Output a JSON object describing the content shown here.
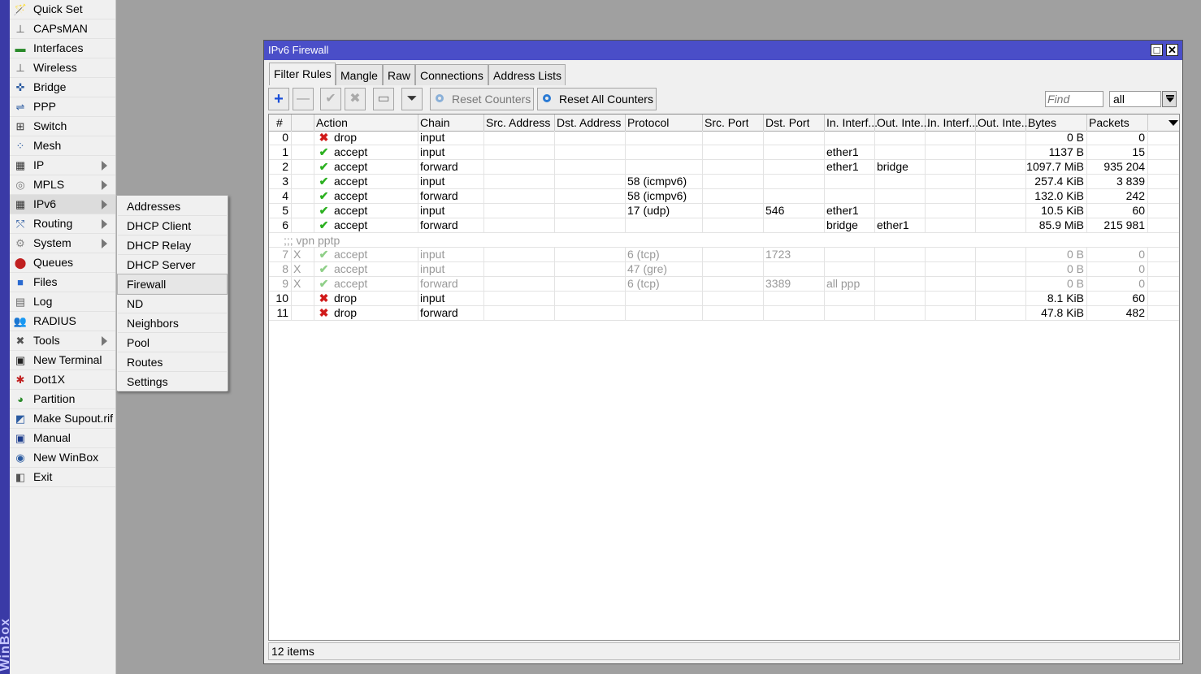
{
  "branding": {
    "side_label": "WinBox"
  },
  "left_menu": [
    {
      "label": "Quick Set",
      "icon": "wand-icon",
      "glyph": "🪄",
      "color": "#555",
      "submenu": false
    },
    {
      "label": "CAPsMAN",
      "icon": "antenna-icon",
      "glyph": "⊥",
      "color": "#555",
      "submenu": false
    },
    {
      "label": "Interfaces",
      "icon": "interfaces-icon",
      "glyph": "▬",
      "color": "#2a8a2a",
      "submenu": false
    },
    {
      "label": "Wireless",
      "icon": "wireless-icon",
      "glyph": "⊥",
      "color": "#555",
      "submenu": false
    },
    {
      "label": "Bridge",
      "icon": "bridge-icon",
      "glyph": "✜",
      "color": "#2a5aa0",
      "submenu": false
    },
    {
      "label": "PPP",
      "icon": "ppp-icon",
      "glyph": "⇌",
      "color": "#2a5aa0",
      "submenu": false
    },
    {
      "label": "Switch",
      "icon": "switch-icon",
      "glyph": "⊞",
      "color": "#333",
      "submenu": false
    },
    {
      "label": "Mesh",
      "icon": "mesh-icon",
      "glyph": "⁘",
      "color": "#2a5aa0",
      "submenu": false
    },
    {
      "label": "IP",
      "icon": "ip-icon",
      "glyph": "▦",
      "color": "#333",
      "submenu": true
    },
    {
      "label": "MPLS",
      "icon": "mpls-icon",
      "glyph": "◎",
      "color": "#777",
      "submenu": true
    },
    {
      "label": "IPv6",
      "icon": "ipv6-icon",
      "glyph": "▦",
      "color": "#333",
      "submenu": true
    },
    {
      "label": "Routing",
      "icon": "routing-icon",
      "glyph": "⤲",
      "color": "#2a5aa0",
      "submenu": true
    },
    {
      "label": "System",
      "icon": "system-gear-icon",
      "glyph": "⚙",
      "color": "#888",
      "submenu": true
    },
    {
      "label": "Queues",
      "icon": "queues-icon",
      "glyph": "⬤",
      "color": "#c02020",
      "submenu": false
    },
    {
      "label": "Files",
      "icon": "files-icon",
      "glyph": "■",
      "color": "#2a6ad0",
      "submenu": false
    },
    {
      "label": "Log",
      "icon": "log-icon",
      "glyph": "▤",
      "color": "#666",
      "submenu": false
    },
    {
      "label": "RADIUS",
      "icon": "radius-icon",
      "glyph": "👥",
      "color": "#2a5aa0",
      "submenu": false
    },
    {
      "label": "Tools",
      "icon": "tools-icon",
      "glyph": "✖",
      "color": "#555",
      "submenu": true
    },
    {
      "label": "New Terminal",
      "icon": "terminal-icon",
      "glyph": "▣",
      "color": "#222",
      "submenu": false
    },
    {
      "label": "Dot1X",
      "icon": "dot1x-icon",
      "glyph": "✱",
      "color": "#c02020",
      "submenu": false
    },
    {
      "label": "Partition",
      "icon": "partition-icon",
      "glyph": "◕",
      "color": "#2a8a2a",
      "submenu": false
    },
    {
      "label": "Make Supout.rif",
      "icon": "supout-icon",
      "glyph": "◩",
      "color": "#2a5aa0",
      "submenu": false
    },
    {
      "label": "Manual",
      "icon": "manual-icon",
      "glyph": "▣",
      "color": "#1a3a8a",
      "submenu": false
    },
    {
      "label": "New WinBox",
      "icon": "winbox-globe-icon",
      "glyph": "◉",
      "color": "#2a5aa0",
      "submenu": false
    },
    {
      "label": "Exit",
      "icon": "exit-icon",
      "glyph": "◧",
      "color": "#555",
      "submenu": false
    }
  ],
  "ipv6_submenu": [
    "Addresses",
    "DHCP Client",
    "DHCP Relay",
    "DHCP Server",
    "Firewall",
    "ND",
    "Neighbors",
    "Pool",
    "Routes",
    "Settings"
  ],
  "window": {
    "title": "IPv6 Firewall",
    "tabs": [
      "Filter Rules",
      "Mangle",
      "Raw",
      "Connections",
      "Address Lists"
    ],
    "toolbar": {
      "reset_counters": "Reset Counters",
      "reset_all_counters": "Reset All Counters"
    },
    "find_placeholder": "Find",
    "filter_value": "all",
    "columns": [
      "#",
      "",
      "Action",
      "Chain",
      "Src. Address",
      "Dst. Address",
      "Protocol",
      "Src. Port",
      "Dst. Port",
      "In. Interf...",
      "Out. Inte...",
      "In. Interf...",
      "Out. Inte...",
      "Bytes",
      "Packets"
    ],
    "rows": [
      {
        "num": "0",
        "flag": "",
        "action": "drop",
        "chain": "input",
        "protocol": "",
        "dst_port": "",
        "in_if": "",
        "out_if": "",
        "bytes": "0 B",
        "packets": "0",
        "disabled": false
      },
      {
        "num": "1",
        "flag": "",
        "action": "accept",
        "chain": "input",
        "protocol": "",
        "dst_port": "",
        "in_if": "ether1",
        "out_if": "",
        "bytes": "1137 B",
        "packets": "15",
        "disabled": false
      },
      {
        "num": "2",
        "flag": "",
        "action": "accept",
        "chain": "forward",
        "protocol": "",
        "dst_port": "",
        "in_if": "ether1",
        "out_if": "bridge",
        "bytes": "1097.7 MiB",
        "packets": "935 204",
        "disabled": false
      },
      {
        "num": "3",
        "flag": "",
        "action": "accept",
        "chain": "input",
        "protocol": "58 (icmpv6)",
        "dst_port": "",
        "in_if": "",
        "out_if": "",
        "bytes": "257.4 KiB",
        "packets": "3 839",
        "disabled": false
      },
      {
        "num": "4",
        "flag": "",
        "action": "accept",
        "chain": "forward",
        "protocol": "58 (icmpv6)",
        "dst_port": "",
        "in_if": "",
        "out_if": "",
        "bytes": "132.0 KiB",
        "packets": "242",
        "disabled": false
      },
      {
        "num": "5",
        "flag": "",
        "action": "accept",
        "chain": "input",
        "protocol": "17 (udp)",
        "dst_port": "546",
        "in_if": "ether1",
        "out_if": "",
        "bytes": "10.5 KiB",
        "packets": "60",
        "disabled": false
      },
      {
        "num": "6",
        "flag": "",
        "action": "accept",
        "chain": "forward",
        "protocol": "",
        "dst_port": "",
        "in_if": "bridge",
        "out_if": "ether1",
        "bytes": "85.9 MiB",
        "packets": "215 981",
        "disabled": false
      },
      {
        "comment": ";;; vpn pptp"
      },
      {
        "num": "7",
        "flag": "X",
        "action": "accept",
        "chain": "input",
        "protocol": "6 (tcp)",
        "dst_port": "1723",
        "in_if": "",
        "out_if": "",
        "bytes": "0 B",
        "packets": "0",
        "disabled": true
      },
      {
        "num": "8",
        "flag": "X",
        "action": "accept",
        "chain": "input",
        "protocol": "47 (gre)",
        "dst_port": "",
        "in_if": "",
        "out_if": "",
        "bytes": "0 B",
        "packets": "0",
        "disabled": true
      },
      {
        "num": "9",
        "flag": "X",
        "action": "accept",
        "chain": "forward",
        "protocol": "6 (tcp)",
        "dst_port": "3389",
        "in_if": "all ppp",
        "out_if": "",
        "bytes": "0 B",
        "packets": "0",
        "disabled": true
      },
      {
        "num": "10",
        "flag": "",
        "action": "drop",
        "chain": "input",
        "protocol": "",
        "dst_port": "",
        "in_if": "",
        "out_if": "",
        "bytes": "8.1 KiB",
        "packets": "60",
        "disabled": false
      },
      {
        "num": "11",
        "flag": "",
        "action": "drop",
        "chain": "forward",
        "protocol": "",
        "dst_port": "",
        "in_if": "",
        "out_if": "",
        "bytes": "47.8 KiB",
        "packets": "482",
        "disabled": false
      }
    ],
    "status": "12 items"
  }
}
